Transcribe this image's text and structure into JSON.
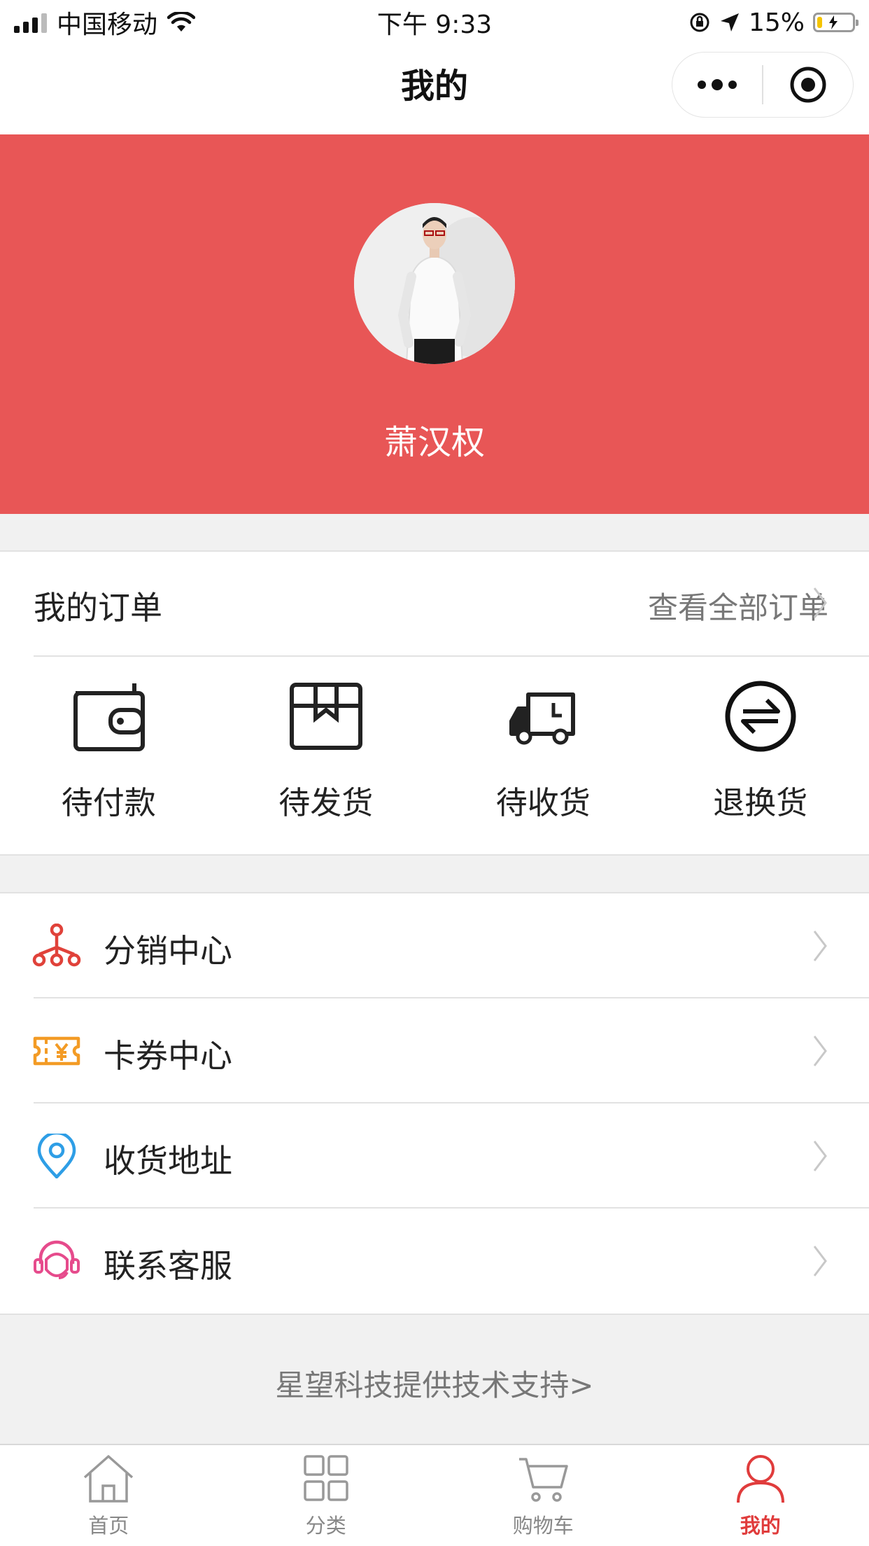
{
  "status_bar": {
    "carrier": "中国移动",
    "time": "下午 9:33",
    "battery_percent": "15%",
    "battery_level": 0.15
  },
  "nav": {
    "title": "我的"
  },
  "profile": {
    "username": "萧汉权"
  },
  "orders": {
    "title": "我的订单",
    "view_all": "查看全部订单",
    "items": [
      {
        "label": "待付款",
        "icon": "wallet-icon"
      },
      {
        "label": "待发货",
        "icon": "box-icon"
      },
      {
        "label": "待收货",
        "icon": "truck-icon"
      },
      {
        "label": "退换货",
        "icon": "exchange-icon"
      }
    ]
  },
  "menu": {
    "items": [
      {
        "label": "分销中心",
        "icon": "distribution-icon",
        "color": "#e0423a"
      },
      {
        "label": "卡券中心",
        "icon": "coupon-icon",
        "color": "#f39b25"
      },
      {
        "label": "收货地址",
        "icon": "location-pin-icon",
        "color": "#2e9ee6"
      },
      {
        "label": "联系客服",
        "icon": "customer-service-icon",
        "color": "#e64b8c"
      }
    ]
  },
  "footer": {
    "support_text": "星望科技提供技术支持>"
  },
  "tab_bar": {
    "items": [
      {
        "label": "首页",
        "icon": "home-icon",
        "active": false
      },
      {
        "label": "分类",
        "icon": "grid-icon",
        "active": false
      },
      {
        "label": "购物车",
        "icon": "cart-icon",
        "active": false
      },
      {
        "label": "我的",
        "icon": "user-icon",
        "active": true
      }
    ]
  },
  "colors": {
    "header_red": "#e85656",
    "active_tab": "#e03c3c",
    "page_bg": "#f1f1f1"
  }
}
